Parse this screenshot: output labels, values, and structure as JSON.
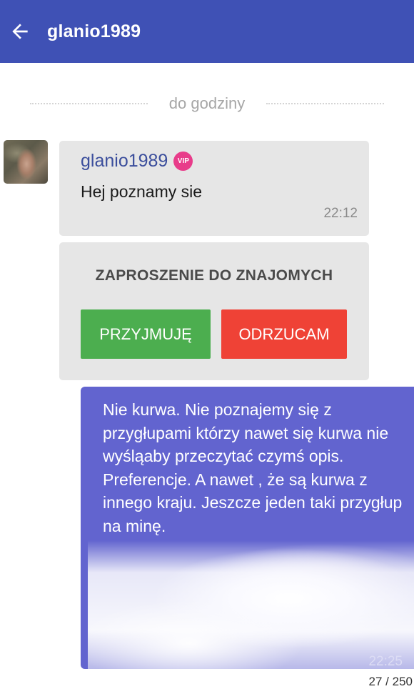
{
  "header": {
    "title": "glanio1989",
    "back_icon": "arrow-left-icon",
    "background": "#3f51b5"
  },
  "date_separator": {
    "label": "do godziny"
  },
  "incoming": {
    "sender": "glanio1989",
    "badge": "VIP",
    "text": "Hej poznamy sie",
    "time": "22:12"
  },
  "invite": {
    "title": "ZAPROSZENIE DO ZNAJOMYCH",
    "accept_label": "PRZYJMUJĘ",
    "reject_label": "ODRZUCAM",
    "accept_color": "#4cae4f",
    "reject_color": "#ef4236"
  },
  "outgoing": {
    "text": "Nie kurwa. Nie poznajemy się z przygłupami którzy nawet się kurwa nie wyśląaby przeczytać czymś opis. Preferencje. A nawet , że są kurwa z innego kraju. Jeszcze jeden taki przygłup na minę.",
    "time": "22:25",
    "background": "#6264cf"
  },
  "footer": {
    "counter": "27 / 250"
  }
}
